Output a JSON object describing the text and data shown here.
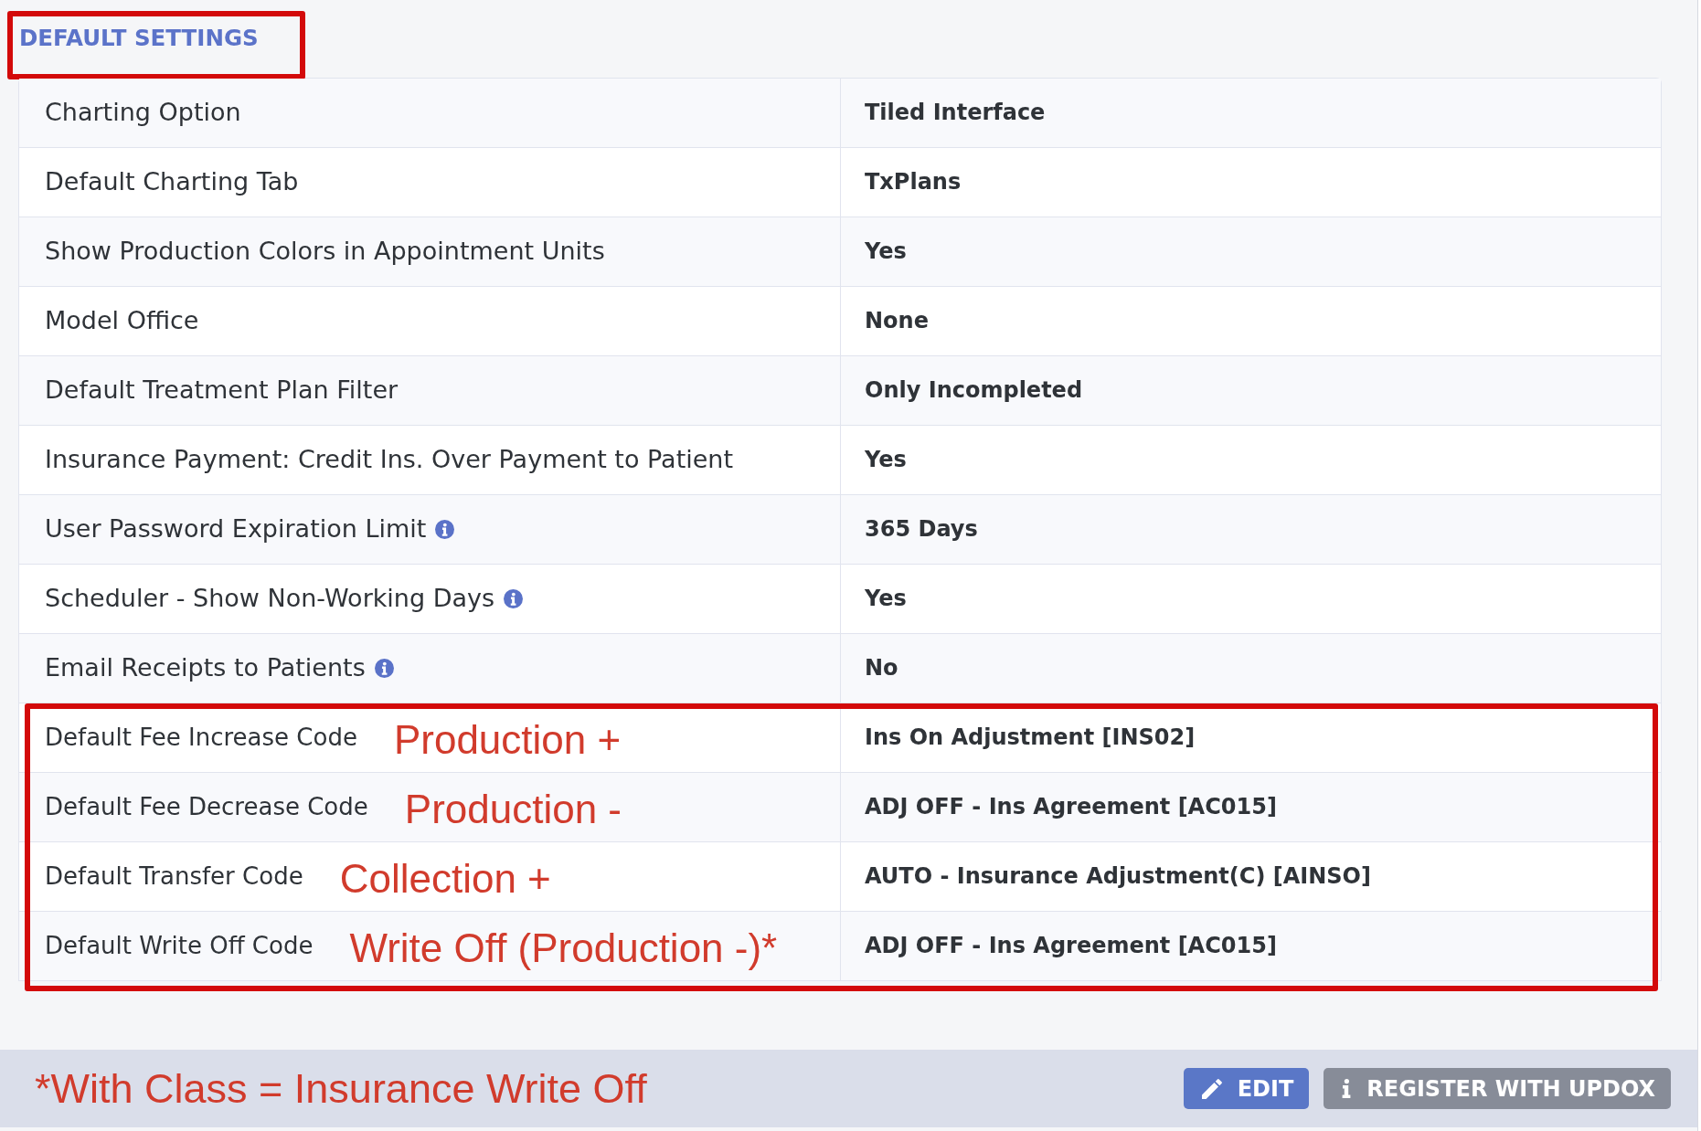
{
  "section": {
    "title": "DEFAULT SETTINGS",
    "highlighted": true
  },
  "table": {
    "row_groups": [
      {
        "highlighted": false,
        "rows": [
          {
            "label": "Charting Option",
            "info": false,
            "value": "Tiled Interface"
          },
          {
            "label": "Default Charting Tab",
            "info": false,
            "value": "TxPlans"
          },
          {
            "label": "Show Production Colors in Appointment Units",
            "info": false,
            "value": "Yes"
          },
          {
            "label": "Model Office",
            "info": false,
            "value": "None"
          },
          {
            "label": "Default Treatment Plan Filter",
            "info": false,
            "value": "Only Incompleted"
          },
          {
            "label": "Insurance Payment: Credit Ins. Over Payment to Patient",
            "info": false,
            "value": "Yes"
          },
          {
            "label": "User Password Expiration Limit",
            "info": true,
            "value": "365 Days"
          },
          {
            "label": "Scheduler - Show Non-Working Days",
            "info": true,
            "value": "Yes"
          },
          {
            "label": "Email Receipts to Patients",
            "info": true,
            "value": "No"
          }
        ]
      },
      {
        "highlighted": true,
        "rows": [
          {
            "label": "Default Fee Increase Code",
            "info": false,
            "annotation": "Production +",
            "value": "Ins On Adjustment [INS02]"
          },
          {
            "label": "Default Fee Decrease Code",
            "info": false,
            "annotation": "Production -",
            "value": "ADJ OFF - Ins Agreement [AC015]"
          },
          {
            "label": "Default Transfer Code",
            "info": false,
            "annotation": "Collection +",
            "value": "AUTO - Insurance Adjustment(C) [AINSO]"
          },
          {
            "label": "Default Write Off Code",
            "info": false,
            "annotation": "Write Off (Production -)*",
            "value": "ADJ OFF - Ins Agreement [AC015]"
          }
        ]
      }
    ]
  },
  "footer": {
    "note": "*With Class = Insurance Write Off",
    "buttons": [
      {
        "label": "EDIT",
        "kind": "primary"
      },
      {
        "label": "REGISTER WITH UPDOX",
        "kind": "secondary"
      }
    ]
  }
}
